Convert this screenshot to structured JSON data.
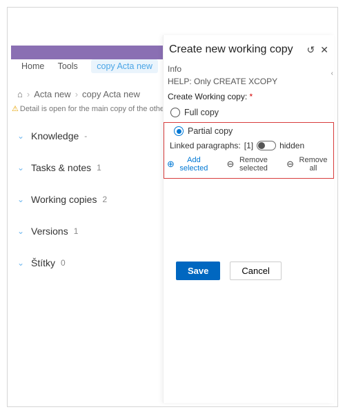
{
  "tabs": {
    "home": "Home",
    "tools": "Tools",
    "active": "copy Acta new"
  },
  "breadcrumb": {
    "seg1": "Acta new",
    "seg2": "copy Acta new"
  },
  "detail_note": "Detail is open for the main copy of the othe",
  "sections": [
    {
      "label": "Knowledge",
      "count": "-"
    },
    {
      "label": "Tasks & notes",
      "count": "1"
    },
    {
      "label": "Working copies",
      "count": "2"
    },
    {
      "label": "Versions",
      "count": "1"
    },
    {
      "label": "Štítky",
      "count": "0"
    }
  ],
  "panel": {
    "title": "Create new working copy",
    "info_label": "Info",
    "help_text": "HELP: Only CREATE XCOPY",
    "create_label": "Create Working copy:",
    "full_copy": "Full copy",
    "partial_copy": "Partial copy",
    "linked_label": "Linked paragraphs:",
    "linked_count": "[1]",
    "hidden_label": "hidden",
    "add_selected": "Add selected",
    "remove_selected": "Remove selected",
    "remove_all": "Remove all",
    "save": "Save",
    "cancel": "Cancel"
  }
}
